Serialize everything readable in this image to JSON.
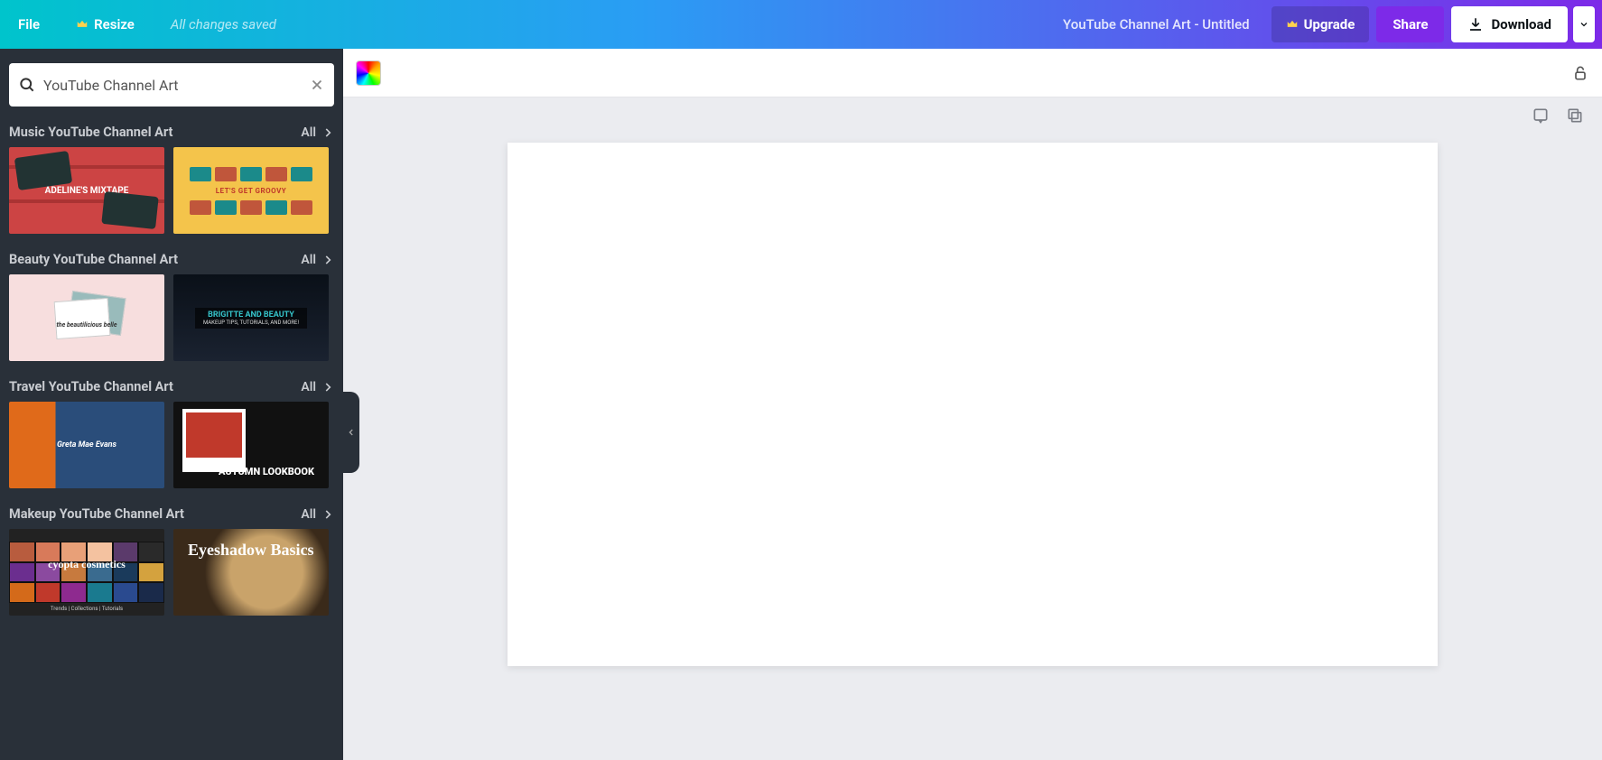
{
  "header": {
    "file": "File",
    "resize": "Resize",
    "status": "All changes saved",
    "title": "YouTube Channel Art - Untitled",
    "upgrade": "Upgrade",
    "share": "Share",
    "download": "Download"
  },
  "sidebar": {
    "search_value": "YouTube Channel Art",
    "all_label": "All",
    "categories": [
      {
        "title": "Music YouTube Channel Art",
        "thumbs": [
          "ADELINE'S MIXTAPE",
          "LET'S GET GROOVY"
        ]
      },
      {
        "title": "Beauty YouTube Channel Art",
        "thumbs": [
          "the beautilicious belle",
          "BRIGITTE AND BEAUTY"
        ]
      },
      {
        "title": "Travel YouTube Channel Art",
        "thumbs": [
          "Greta Mae Evans",
          "AUTUMN LOOKBOOK"
        ]
      },
      {
        "title": "Makeup YouTube Channel Art",
        "thumbs": [
          "cyopta cosmetics",
          "Eyeshadow Basics"
        ]
      }
    ]
  },
  "thumb_subtexts": {
    "beauty2_sub": "MAKEUP TIPS, TUTORIALS, AND MORE!",
    "makeup1_sub": "Trends | Collections | Tutorials"
  }
}
